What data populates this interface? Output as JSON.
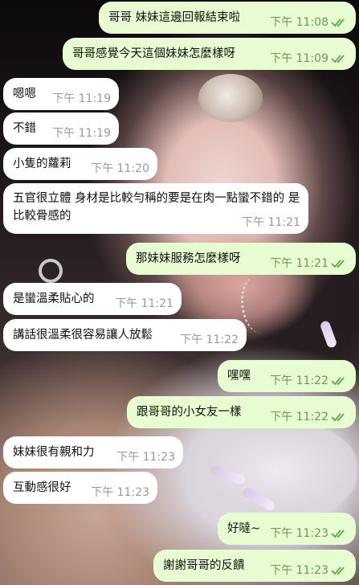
{
  "chat": {
    "messages": [
      {
        "dir": "out",
        "text": "哥哥 妹妹這邊回報結束啦",
        "time": "下午 11:08",
        "read": true
      },
      {
        "dir": "out",
        "text": "哥哥感覺今天這個妹妹怎麼樣呀",
        "time": "下午 11:09",
        "read": true
      },
      {
        "dir": "in",
        "text": "嗯嗯",
        "time": "下午 11:19"
      },
      {
        "dir": "in",
        "text": "不錯",
        "time": "下午 11:19"
      },
      {
        "dir": "in",
        "text": "小隻的蘿莉",
        "time": "下午 11:20"
      },
      {
        "dir": "in",
        "text": "五官很立體 身材是比較勻稱的要是在肉一點蠻不錯的 是比較骨感的",
        "time": "下午 11:21"
      },
      {
        "dir": "out",
        "text": "那妹妹服務怎麼樣呀",
        "time": "下午 11:21",
        "read": true
      },
      {
        "dir": "in",
        "text": "是蠻溫柔貼心的",
        "time": "下午 11:21"
      },
      {
        "dir": "in",
        "text": "講話很溫柔很容易讓人放鬆",
        "time": "下午 11:22"
      },
      {
        "dir": "out",
        "text": "嘿嘿",
        "time": "下午 11:22",
        "read": true
      },
      {
        "dir": "out",
        "text": "跟哥哥的小女友一樣",
        "time": "下午 11:22",
        "read": true
      },
      {
        "dir": "in",
        "text": "妹妹很有親和力",
        "time": "下午 11:23"
      },
      {
        "dir": "in",
        "text": "互動感很好",
        "time": "下午 11:23"
      },
      {
        "dir": "out",
        "text": "好噠~",
        "time": "下午 11:23",
        "read": true
      },
      {
        "dir": "out",
        "text": "謝謝哥哥的反饋",
        "time": "下午 11:23",
        "read": true
      }
    ]
  },
  "colors": {
    "incoming": "#ffffff",
    "outgoing": "#e7fdd1",
    "tick": "#5fa84a"
  },
  "icons": {
    "read_receipt": "double-check-icon"
  }
}
